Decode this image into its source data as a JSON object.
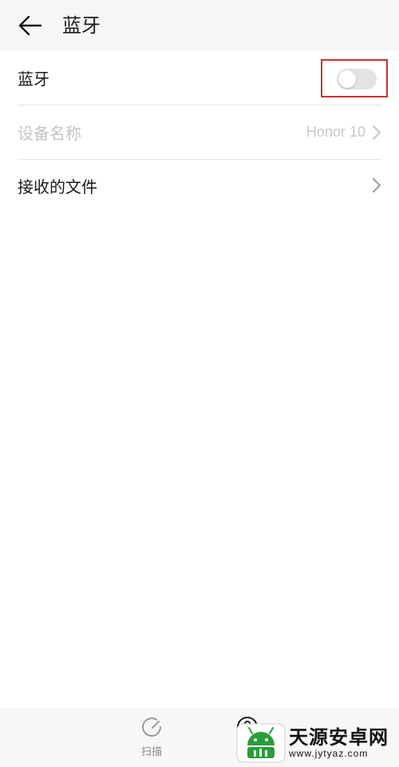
{
  "header": {
    "title": "蓝牙",
    "back_icon": "arrow-left-icon"
  },
  "settings": {
    "bluetooth": {
      "label": "蓝牙",
      "enabled": false
    },
    "device_name": {
      "label": "设备名称",
      "value": "Honor 10",
      "disabled": true
    },
    "received_files": {
      "label": "接收的文件"
    }
  },
  "bottom_bar": {
    "scan_label": "扫描",
    "scan_icon": "refresh-icon",
    "help_icon": "help-icon"
  },
  "watermark": {
    "logo": "android-logo",
    "text": "天源安卓网",
    "url": "www.jytyaz.com"
  },
  "colors": {
    "highlight_box": "#d12f2f",
    "header_bg": "#f6f6f6",
    "toggle_off": "#e3e3e3",
    "watermark_green": "#2a9c3a"
  }
}
